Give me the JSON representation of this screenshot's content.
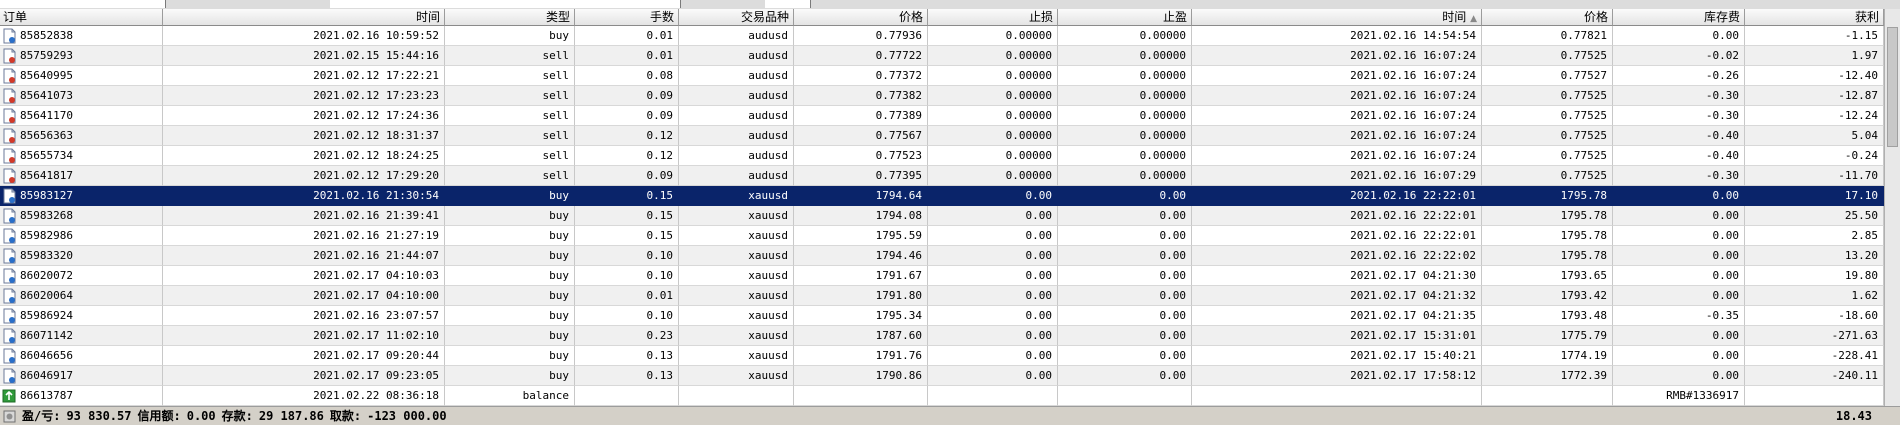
{
  "columns": [
    "订单",
    "时间",
    "类型",
    "手数",
    "交易品种",
    "价格",
    "止损",
    "止盈",
    "时间",
    "价格",
    "库存费",
    "获利"
  ],
  "rows": [
    {
      "order": "85852838",
      "time": "2021.02.16 10:59:52",
      "type": "buy",
      "lots": "0.01",
      "symbol": "audusd",
      "price": "0.77936",
      "sl": "0.00000",
      "tp": "0.00000",
      "close_time": "2021.02.16 14:54:54",
      "close_price": "0.77821",
      "swap": "0.00",
      "profit": "-1.15",
      "icon": "buy-order-icon"
    },
    {
      "order": "85759293",
      "time": "2021.02.15 15:44:16",
      "type": "sell",
      "lots": "0.01",
      "symbol": "audusd",
      "price": "0.77722",
      "sl": "0.00000",
      "tp": "0.00000",
      "close_time": "2021.02.16 16:07:24",
      "close_price": "0.77525",
      "swap": "-0.02",
      "profit": "1.97",
      "icon": "sell-order-icon"
    },
    {
      "order": "85640995",
      "time": "2021.02.12 17:22:21",
      "type": "sell",
      "lots": "0.08",
      "symbol": "audusd",
      "price": "0.77372",
      "sl": "0.00000",
      "tp": "0.00000",
      "close_time": "2021.02.16 16:07:24",
      "close_price": "0.77527",
      "swap": "-0.26",
      "profit": "-12.40",
      "icon": "sell-order-icon"
    },
    {
      "order": "85641073",
      "time": "2021.02.12 17:23:23",
      "type": "sell",
      "lots": "0.09",
      "symbol": "audusd",
      "price": "0.77382",
      "sl": "0.00000",
      "tp": "0.00000",
      "close_time": "2021.02.16 16:07:24",
      "close_price": "0.77525",
      "swap": "-0.30",
      "profit": "-12.87",
      "icon": "sell-order-icon"
    },
    {
      "order": "85641170",
      "time": "2021.02.12 17:24:36",
      "type": "sell",
      "lots": "0.09",
      "symbol": "audusd",
      "price": "0.77389",
      "sl": "0.00000",
      "tp": "0.00000",
      "close_time": "2021.02.16 16:07:24",
      "close_price": "0.77525",
      "swap": "-0.30",
      "profit": "-12.24",
      "icon": "sell-order-icon"
    },
    {
      "order": "85656363",
      "time": "2021.02.12 18:31:37",
      "type": "sell",
      "lots": "0.12",
      "symbol": "audusd",
      "price": "0.77567",
      "sl": "0.00000",
      "tp": "0.00000",
      "close_time": "2021.02.16 16:07:24",
      "close_price": "0.77525",
      "swap": "-0.40",
      "profit": "5.04",
      "icon": "sell-order-icon"
    },
    {
      "order": "85655734",
      "time": "2021.02.12 18:24:25",
      "type": "sell",
      "lots": "0.12",
      "symbol": "audusd",
      "price": "0.77523",
      "sl": "0.00000",
      "tp": "0.00000",
      "close_time": "2021.02.16 16:07:24",
      "close_price": "0.77525",
      "swap": "-0.40",
      "profit": "-0.24",
      "icon": "sell-order-icon"
    },
    {
      "order": "85641817",
      "time": "2021.02.12 17:29:20",
      "type": "sell",
      "lots": "0.09",
      "symbol": "audusd",
      "price": "0.77395",
      "sl": "0.00000",
      "tp": "0.00000",
      "close_time": "2021.02.16 16:07:29",
      "close_price": "0.77525",
      "swap": "-0.30",
      "profit": "-11.70",
      "icon": "sell-order-icon"
    },
    {
      "order": "85983127",
      "time": "2021.02.16 21:30:54",
      "type": "buy",
      "lots": "0.15",
      "symbol": "xauusd",
      "price": "1794.64",
      "sl": "0.00",
      "tp": "0.00",
      "close_time": "2021.02.16 22:22:01",
      "close_price": "1795.78",
      "swap": "0.00",
      "profit": "17.10",
      "icon": "buy-order-icon",
      "selected": true
    },
    {
      "order": "85983268",
      "time": "2021.02.16 21:39:41",
      "type": "buy",
      "lots": "0.15",
      "symbol": "xauusd",
      "price": "1794.08",
      "sl": "0.00",
      "tp": "0.00",
      "close_time": "2021.02.16 22:22:01",
      "close_price": "1795.78",
      "swap": "0.00",
      "profit": "25.50",
      "icon": "buy-order-icon"
    },
    {
      "order": "85982986",
      "time": "2021.02.16 21:27:19",
      "type": "buy",
      "lots": "0.15",
      "symbol": "xauusd",
      "price": "1795.59",
      "sl": "0.00",
      "tp": "0.00",
      "close_time": "2021.02.16 22:22:01",
      "close_price": "1795.78",
      "swap": "0.00",
      "profit": "2.85",
      "icon": "buy-order-icon"
    },
    {
      "order": "85983320",
      "time": "2021.02.16 21:44:07",
      "type": "buy",
      "lots": "0.10",
      "symbol": "xauusd",
      "price": "1794.46",
      "sl": "0.00",
      "tp": "0.00",
      "close_time": "2021.02.16 22:22:02",
      "close_price": "1795.78",
      "swap": "0.00",
      "profit": "13.20",
      "icon": "buy-order-icon"
    },
    {
      "order": "86020072",
      "time": "2021.02.17 04:10:03",
      "type": "buy",
      "lots": "0.10",
      "symbol": "xauusd",
      "price": "1791.67",
      "sl": "0.00",
      "tp": "0.00",
      "close_time": "2021.02.17 04:21:30",
      "close_price": "1793.65",
      "swap": "0.00",
      "profit": "19.80",
      "icon": "buy-order-icon"
    },
    {
      "order": "86020064",
      "time": "2021.02.17 04:10:00",
      "type": "buy",
      "lots": "0.01",
      "symbol": "xauusd",
      "price": "1791.80",
      "sl": "0.00",
      "tp": "0.00",
      "close_time": "2021.02.17 04:21:32",
      "close_price": "1793.42",
      "swap": "0.00",
      "profit": "1.62",
      "icon": "buy-order-icon"
    },
    {
      "order": "85986924",
      "time": "2021.02.16 23:07:57",
      "type": "buy",
      "lots": "0.10",
      "symbol": "xauusd",
      "price": "1795.34",
      "sl": "0.00",
      "tp": "0.00",
      "close_time": "2021.02.17 04:21:35",
      "close_price": "1793.48",
      "swap": "-0.35",
      "profit": "-18.60",
      "icon": "buy-order-icon"
    },
    {
      "order": "86071142",
      "time": "2021.02.17 11:02:10",
      "type": "buy",
      "lots": "0.23",
      "symbol": "xauusd",
      "price": "1787.60",
      "sl": "0.00",
      "tp": "0.00",
      "close_time": "2021.02.17 15:31:01",
      "close_price": "1775.79",
      "swap": "0.00",
      "profit": "-271.63",
      "icon": "buy-order-icon"
    },
    {
      "order": "86046656",
      "time": "2021.02.17 09:20:44",
      "type": "buy",
      "lots": "0.13",
      "symbol": "xauusd",
      "price": "1791.76",
      "sl": "0.00",
      "tp": "0.00",
      "close_time": "2021.02.17 15:40:21",
      "close_price": "1774.19",
      "swap": "0.00",
      "profit": "-228.41",
      "icon": "buy-order-icon"
    },
    {
      "order": "86046917",
      "time": "2021.02.17 09:23:05",
      "type": "buy",
      "lots": "0.13",
      "symbol": "xauusd",
      "price": "1790.86",
      "sl": "0.00",
      "tp": "0.00",
      "close_time": "2021.02.17 17:58:12",
      "close_price": "1772.39",
      "swap": "0.00",
      "profit": "-240.11",
      "icon": "buy-order-icon"
    },
    {
      "order": "86613787",
      "time": "2021.02.22 08:36:18",
      "type": "balance",
      "lots": "",
      "symbol": "",
      "price": "",
      "sl": "",
      "tp": "",
      "close_time": "",
      "close_price": "",
      "swap": "RMB#1336917",
      "profit": "",
      "icon": "balance-icon"
    }
  ],
  "status": {
    "pl_label": "盈/亏:",
    "pl_value": "93 830.57",
    "credit_label": "信用额:",
    "credit_value": "0.00",
    "deposit_label": "存款:",
    "deposit_value": "29 187.86",
    "withdraw_label": "取款:",
    "withdraw_value": "-123 000.00",
    "total": "18.43"
  },
  "colors": {
    "selected_row": "#0a246a",
    "alt_row": "#f0f0f0"
  }
}
